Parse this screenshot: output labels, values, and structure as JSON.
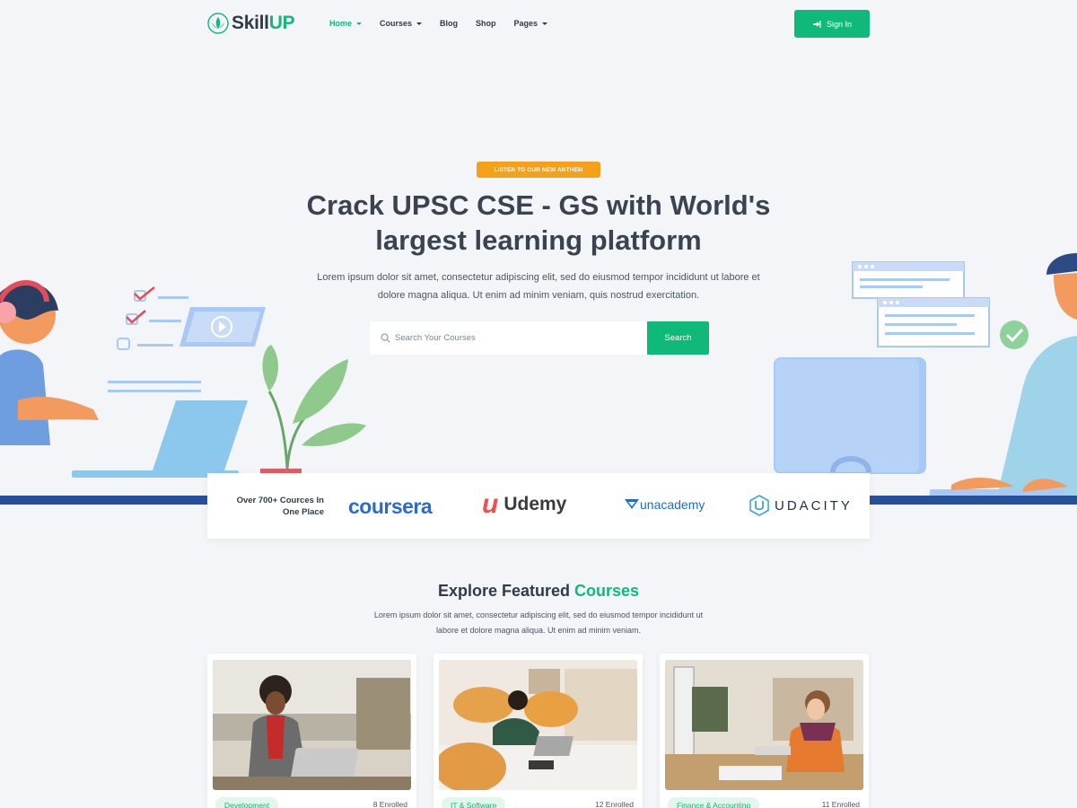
{
  "brand": {
    "name_part1": "Skill",
    "name_part2": "UP"
  },
  "nav": {
    "items": [
      {
        "label": "Home",
        "dropdown": true,
        "active": true
      },
      {
        "label": "Courses",
        "dropdown": true,
        "active": false
      },
      {
        "label": "Blog",
        "dropdown": false,
        "active": false
      },
      {
        "label": "Shop",
        "dropdown": false,
        "active": false
      },
      {
        "label": "Pages",
        "dropdown": true,
        "active": false
      }
    ],
    "signin_label": "Sign In"
  },
  "hero": {
    "badge": "LISTEN TO OUR NEW ANTHEM",
    "title_line1": "Crack UPSC CSE - GS with World's",
    "title_line2": "largest learning platform",
    "subtitle_line1": "Lorem ipsum dolor sit amet, consectetur adipiscing elit, sed do eiusmod tempor incididunt ut labore et",
    "subtitle_line2": "dolore magna aliqua. Ut enim ad minim veniam, quis nostrud exercitation.",
    "search_placeholder": "Search Your Courses",
    "search_button": "Search"
  },
  "partners": {
    "label_line1": "Over 700+ Cources In",
    "label_line2": "One Place",
    "logos": {
      "coursera": "coursera",
      "udemy_mark": "u",
      "udemy": "Udemy",
      "unacademy": "unacademy",
      "udacity": "UDACITY"
    }
  },
  "featured": {
    "title_part1": "Explore Featured ",
    "title_part2": "Courses",
    "subtitle_line1": "Lorem ipsum dolor sit amet, consectetur adipiscing elit, sed do eiusmod tempor incididunt ut",
    "subtitle_line2": "labore et dolore magna aliqua. Ut enim ad minim veniam.",
    "cards": [
      {
        "category": "Development",
        "enrolled": "8 Enrolled"
      },
      {
        "category": "IT & Software",
        "enrolled": "12 Enrolled"
      },
      {
        "category": "Finance & Accounting",
        "enrolled": "11 Enrolled"
      }
    ]
  },
  "colors": {
    "accent": "#0fb97a",
    "badge": "#f6a019",
    "ground": "#27509a",
    "illustration_blue": "#a8c8f5"
  }
}
